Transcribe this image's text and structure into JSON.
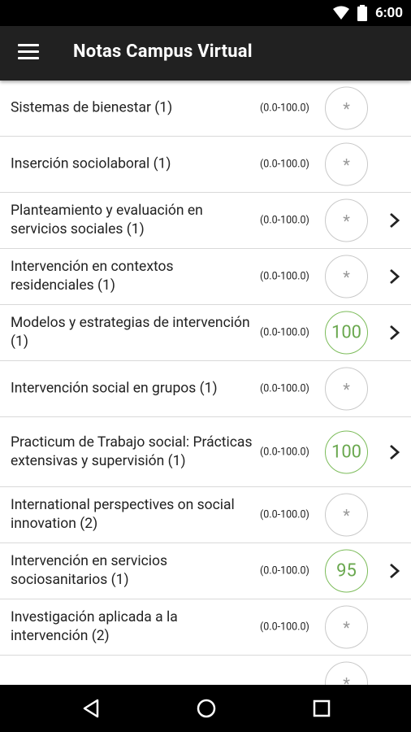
{
  "status": {
    "time": "6:00"
  },
  "appbar": {
    "title": "Notas Campus Virtual"
  },
  "courses": [
    {
      "name": "Sistemas de bienestar (1)",
      "range": "(0.0-100.0)",
      "grade": "*",
      "status": "pending",
      "has_detail": false
    },
    {
      "name": "Inserción sociolaboral (1)",
      "range": "(0.0-100.0)",
      "grade": "*",
      "status": "pending",
      "has_detail": false
    },
    {
      "name": "Planteamiento y evaluación en servicios sociales (1)",
      "range": "(0.0-100.0)",
      "grade": "*",
      "status": "pending",
      "has_detail": true
    },
    {
      "name": "Intervención en contextos residenciales (1)",
      "range": "(0.0-100.0)",
      "grade": "*",
      "status": "pending",
      "has_detail": true
    },
    {
      "name": "Modelos y estrategias de intervención (1)",
      "range": "(0.0-100.0)",
      "grade": "100",
      "status": "pass",
      "has_detail": true
    },
    {
      "name": "Intervención social en grupos (1)",
      "range": "(0.0-100.0)",
      "grade": "*",
      "status": "pending",
      "has_detail": false
    },
    {
      "name": "Practicum de Trabajo social: Prácticas extensivas y supervisión (1)",
      "range": "(0.0-100.0)",
      "grade": "100",
      "status": "pass",
      "has_detail": true,
      "tall": true
    },
    {
      "name": "International perspectives on social innovation (2)",
      "range": "(0.0-100.0)",
      "grade": "*",
      "status": "pending",
      "has_detail": false
    },
    {
      "name": "Intervención en servicios sociosanitarios (1)",
      "range": "(0.0-100.0)",
      "grade": "95",
      "status": "pass",
      "has_detail": true
    },
    {
      "name": "Investigación aplicada a la intervención (2)",
      "range": "(0.0-100.0)",
      "grade": "*",
      "status": "pending",
      "has_detail": false
    },
    {
      "name": "",
      "range": "",
      "grade": "*",
      "status": "pending",
      "has_detail": false
    }
  ],
  "colors": {
    "pass": "#6aa84f",
    "pending": "#9a9a9a",
    "appbar": "#212121"
  },
  "icons": {
    "menu": "menu-icon",
    "wifi": "wifi-icon",
    "battery": "battery-icon",
    "back": "back-icon",
    "home": "home-icon",
    "recents": "recents-icon",
    "chevron": "chevron-right-icon"
  }
}
